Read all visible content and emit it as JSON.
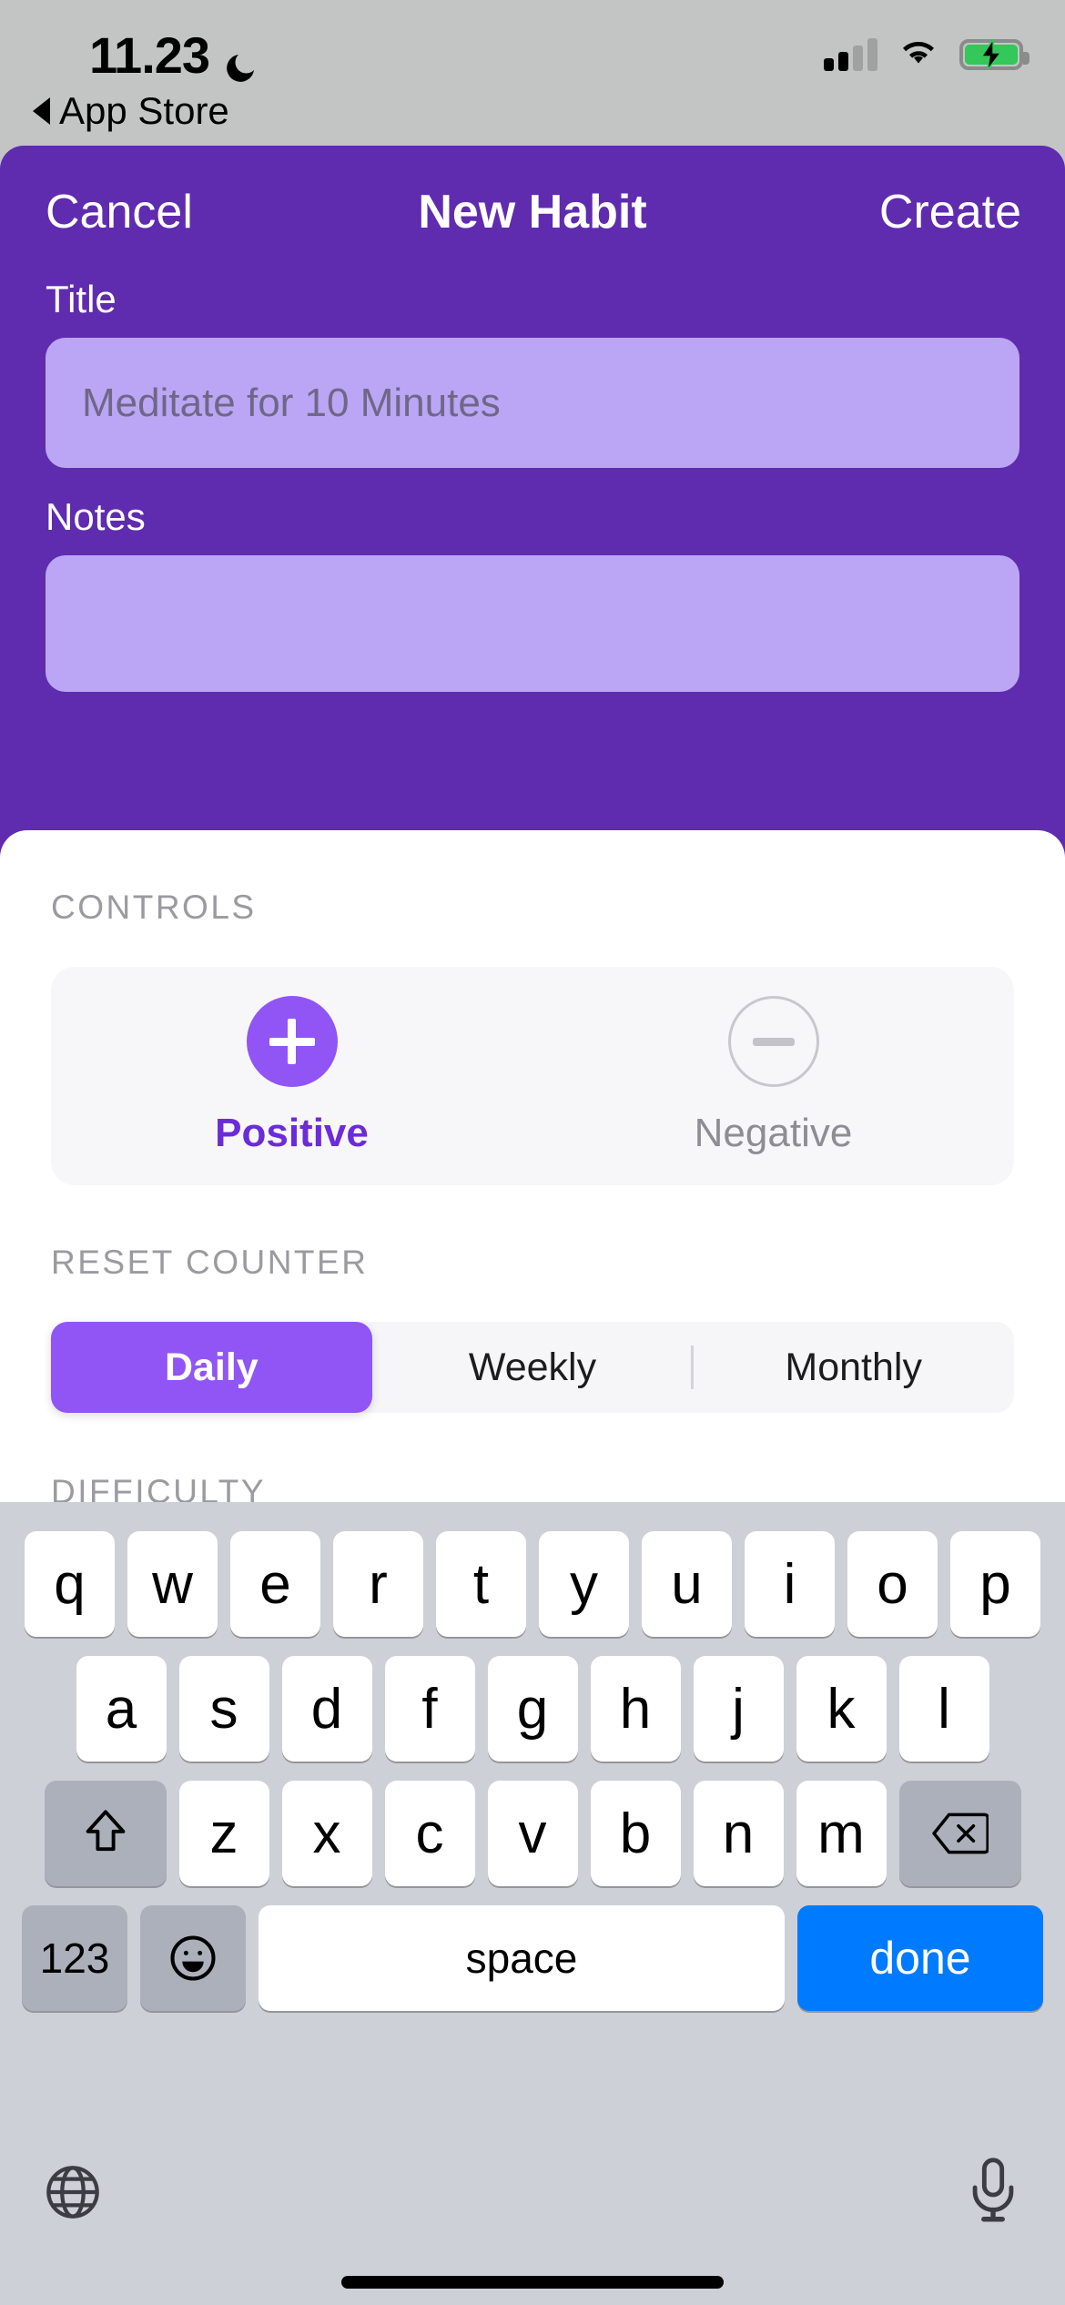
{
  "status_bar": {
    "time": "11.23",
    "dnd_icon": "moon-icon",
    "back_label": "App Store",
    "signal_icon": "cellular-signal-icon",
    "wifi_icon": "wifi-icon",
    "battery_icon": "battery-charging-icon",
    "battery_color": "#34C759"
  },
  "navbar": {
    "cancel_label": "Cancel",
    "title": "New Habit",
    "create_label": "Create"
  },
  "form": {
    "title_label": "Title",
    "title_value": "",
    "title_placeholder": "Meditate for 10 Minutes",
    "notes_label": "Notes",
    "notes_value": "",
    "notes_placeholder": ""
  },
  "controls": {
    "section_label": "CONTROLS",
    "options": [
      {
        "label": "Positive",
        "icon": "plus-icon",
        "selected": true
      },
      {
        "label": "Negative",
        "icon": "minus-icon",
        "selected": false
      }
    ]
  },
  "reset_counter": {
    "section_label": "RESET COUNTER",
    "options": [
      "Daily",
      "Weekly",
      "Monthly"
    ],
    "selected": "Daily"
  },
  "difficulty": {
    "section_label": "DIFFICULTY"
  },
  "keyboard": {
    "row1": [
      "q",
      "w",
      "e",
      "r",
      "t",
      "y",
      "u",
      "i",
      "o",
      "p"
    ],
    "row2": [
      "a",
      "s",
      "d",
      "f",
      "g",
      "h",
      "j",
      "k",
      "l"
    ],
    "row3": [
      "z",
      "x",
      "c",
      "v",
      "b",
      "n",
      "m"
    ],
    "shift_icon": "shift-icon",
    "backspace_icon": "backspace-icon",
    "numbers_label": "123",
    "emoji_icon": "emoji-icon",
    "space_label": "space",
    "done_label": "done",
    "globe_icon": "globe-icon",
    "mic_icon": "microphone-icon"
  },
  "colors": {
    "sheet_purple": "#5F2CAF",
    "input_lavender": "#BBA6F5",
    "accent_purple": "#9155F5",
    "selected_text_purple": "#6C2BD9",
    "done_blue": "#007AFF",
    "keyboard_bg": "#CDD0D6"
  }
}
